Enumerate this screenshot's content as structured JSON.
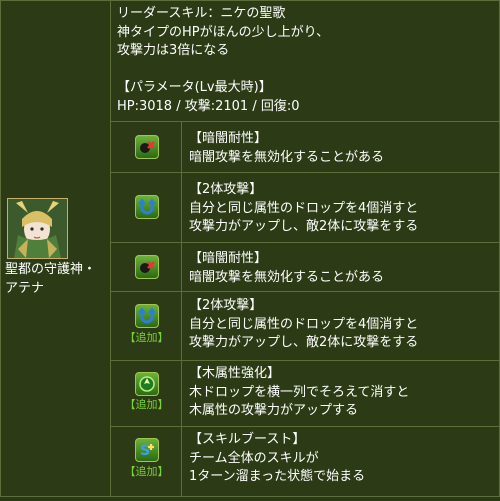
{
  "monster": {
    "name_line1": "聖都の守護神・",
    "name_line2": "アテナ"
  },
  "leader": {
    "line1": "リーダースキル：ニケの聖歌",
    "line2": "神タイプのHPがほんの少し上がり、",
    "line3": "攻撃力は3倍になる",
    "params_header": "【パラメータ(Lv最大時)】",
    "stats": "HP:3018 / 攻撃:2101 / 回復:0"
  },
  "awakenings": [
    {
      "icon": "dark-resist-icon",
      "added_label": "",
      "title": "【暗闇耐性】",
      "lines": [
        "暗闇攻撃を無効化することがある"
      ]
    },
    {
      "icon": "two-pronged-attack-icon",
      "added_label": "",
      "title": "【2体攻撃】",
      "lines": [
        "自分と同じ属性のドロップを4個消すと",
        "攻撃力がアップし、敵2体に攻撃をする"
      ]
    },
    {
      "icon": "dark-resist-icon",
      "added_label": "",
      "title": "【暗闇耐性】",
      "lines": [
        "暗闇攻撃を無効化することがある"
      ]
    },
    {
      "icon": "two-pronged-attack-icon",
      "added_label": "【追加】",
      "title": "【2体攻撃】",
      "lines": [
        "自分と同じ属性のドロップを4個消すと",
        "攻撃力がアップし、敵2体に攻撃をする"
      ]
    },
    {
      "icon": "wood-row-enhance-icon",
      "added_label": "【追加】",
      "title": "【木属性強化】",
      "lines": [
        "木ドロップを横一列でそろえて消すと",
        "木属性の攻撃力がアップする"
      ]
    },
    {
      "icon": "skill-boost-icon",
      "added_label": "【追加】",
      "title": "【スキルブースト】",
      "lines": [
        "チーム全体のスキルが",
        "1ターン溜まった状態で始まる"
      ]
    }
  ]
}
